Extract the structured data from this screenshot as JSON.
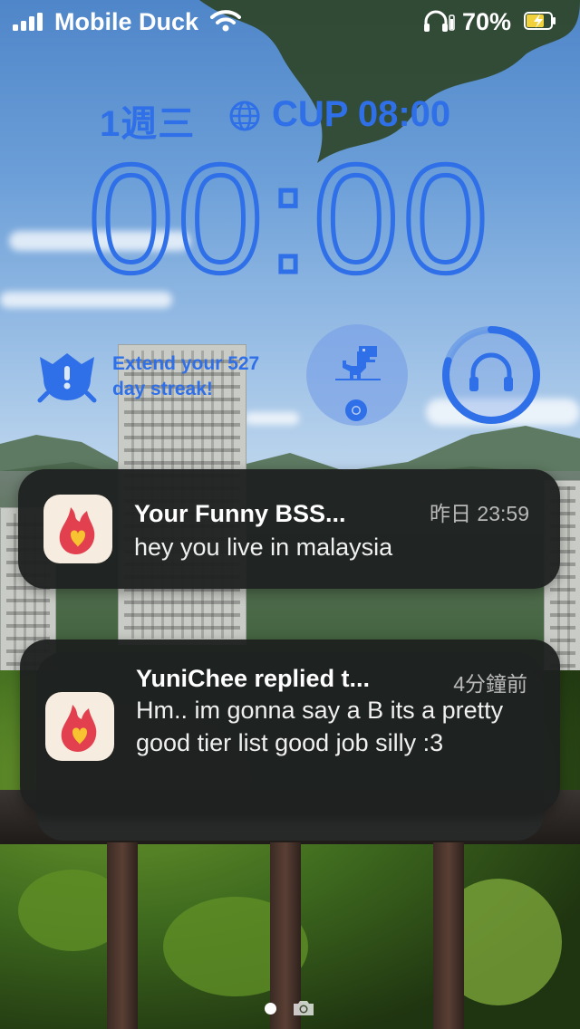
{
  "status_bar": {
    "carrier": "Mobile Duck",
    "battery_percent": "70%",
    "signal_bars": 4,
    "icons": [
      "signal-icon",
      "wifi-icon",
      "headphones-icon",
      "battery-charging-icon"
    ]
  },
  "lock_screen": {
    "date": "1週三",
    "world_clock": "CUP 08:00",
    "time": "00:00",
    "accent_color": "#2f6fe8"
  },
  "widgets": {
    "duolingo_streak": "Extend your 527 day streak!",
    "dino_icon": "dino-icon",
    "chrome_icon": "chrome-icon",
    "headphones_icon": "headphones-icon",
    "headphones_battery_level": 0.8
  },
  "notifications": [
    {
      "title": "Your Funny BSS...",
      "time": "昨日 23:59",
      "body": "hey you live in malaysia",
      "icon": "app-flame-heart-icon"
    },
    {
      "title": "YuniChee replied t...",
      "time": "4分鐘前",
      "body": "Hm.. im gonna say a B its a pretty good tier list good job silly :3",
      "icon": "app-flame-heart-icon"
    }
  ],
  "bottom": {
    "camera_icon": "camera-icon"
  }
}
